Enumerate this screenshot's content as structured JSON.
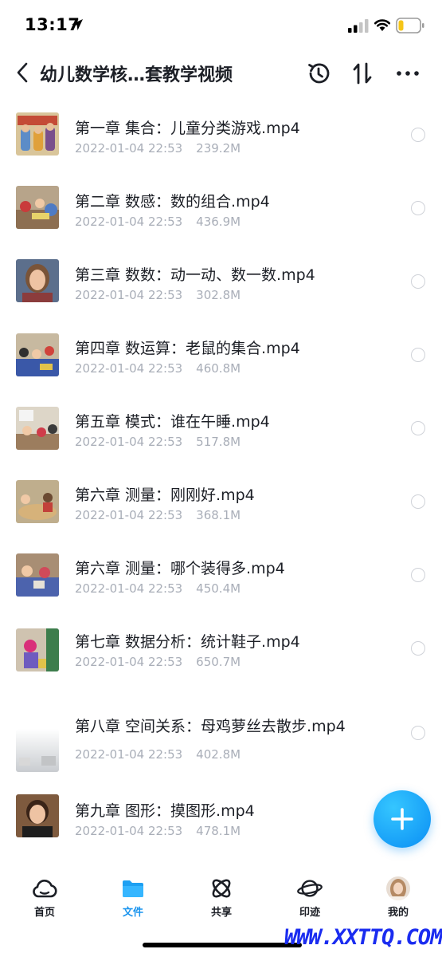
{
  "status_bar": {
    "time": "13:17"
  },
  "header": {
    "title": "幼儿数学核…套教学视频"
  },
  "files": [
    {
      "name": "第一章 集合：儿童分类游戏.mp4",
      "date": "2022-01-04 22:53",
      "size": "239.2M",
      "thumb": "book-cover-thumbnail"
    },
    {
      "name": "第二章 数感：数的组合.mp4",
      "date": "2022-01-04 22:53",
      "size": "436.9M",
      "thumb": "classroom-thumbnail"
    },
    {
      "name": "第三章 数数：动一动、数一数.mp4",
      "date": "2022-01-04 22:53",
      "size": "302.8M",
      "thumb": "teacher-portrait-thumbnail"
    },
    {
      "name": "第四章 数运算：老鼠的集合.mp4",
      "date": "2022-01-04 22:53",
      "size": "460.8M",
      "thumb": "classroom-thumbnail"
    },
    {
      "name": "第五章 模式：谁在午睡.mp4",
      "date": "2022-01-04 22:53",
      "size": "517.8M",
      "thumb": "classroom-thumbnail"
    },
    {
      "name": "第六章 测量：刚刚好.mp4",
      "date": "2022-01-04 22:53",
      "size": "368.1M",
      "thumb": "classroom-thumbnail"
    },
    {
      "name": "第六章 测量：哪个装得多.mp4",
      "date": "2022-01-04 22:53",
      "size": "450.4M",
      "thumb": "classroom-thumbnail"
    },
    {
      "name": "第七章 数据分析：统计鞋子.mp4",
      "date": "2022-01-04 22:53",
      "size": "650.7M",
      "thumb": "classroom-thumbnail"
    },
    {
      "name": "第八章 空间关系：母鸡萝丝去散步.mp4",
      "date": "2022-01-04 22:53",
      "size": "402.8M",
      "thumb": "faded-thumbnail"
    },
    {
      "name": "第九章 图形：摸图形.mp4",
      "date": "2022-01-04 22:53",
      "size": "478.1M",
      "thumb": "teacher-portrait-thumbnail"
    }
  ],
  "nav": {
    "items": [
      {
        "label": "首页",
        "icon": "cloud-icon"
      },
      {
        "label": "文件",
        "icon": "folder-icon"
      },
      {
        "label": "共享",
        "icon": "atom-icon"
      },
      {
        "label": "印迹",
        "icon": "planet-icon"
      },
      {
        "label": "我的",
        "icon": "avatar"
      }
    ],
    "active": "文件"
  },
  "watermark": "WWW.XXTTQ.COM",
  "colors": {
    "accent": "#1a94ee",
    "meta_text": "#a9aeb8",
    "primary_text": "#1c1f26"
  }
}
